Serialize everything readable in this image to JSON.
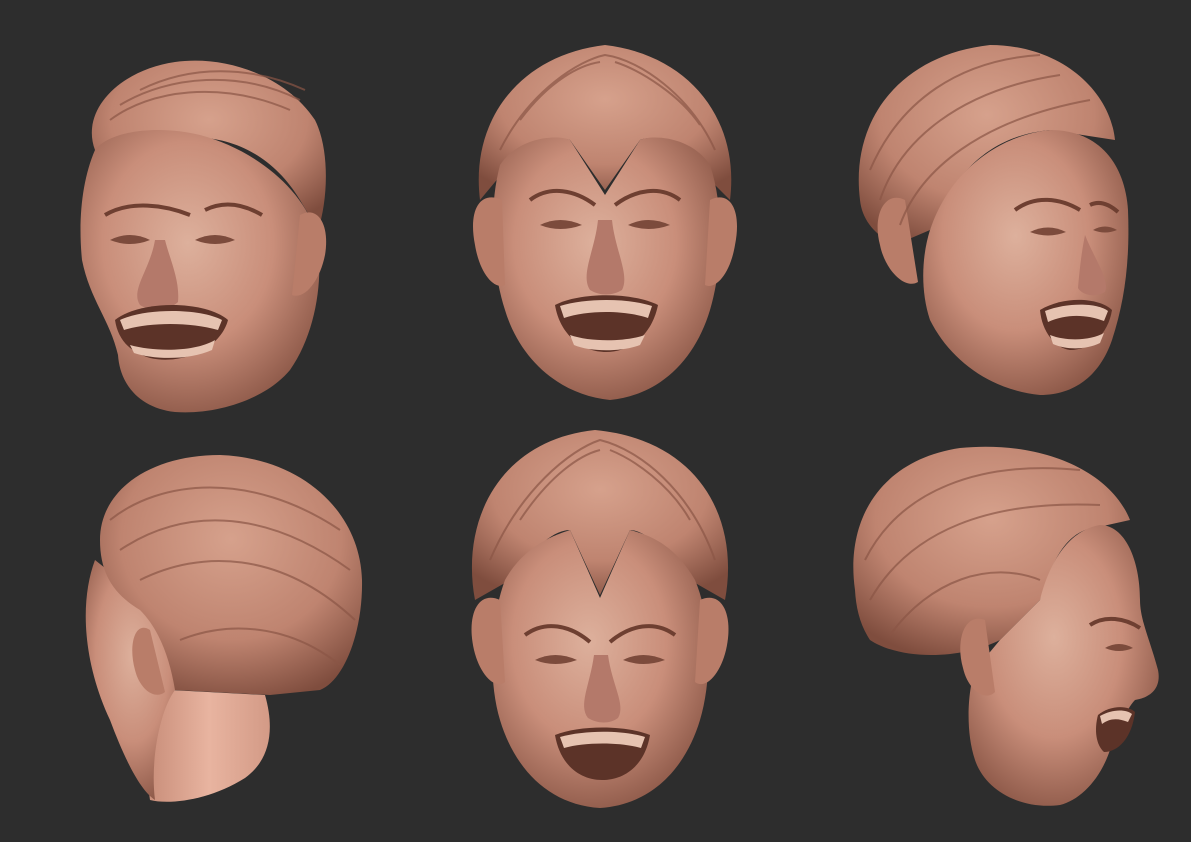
{
  "canvas": {
    "background_color": "#2d2d2d"
  },
  "palette": {
    "clay_base": "#c98e7a",
    "clay_light": "#ddb09c",
    "clay_shadow": "#8a5646",
    "clay_deep": "#5c3328",
    "teeth": "#e6c3b1",
    "neck_cut": "#e3aa97"
  },
  "views": [
    {
      "name": "view-three-quarter-left",
      "angle": "three-quarter-left"
    },
    {
      "name": "view-front",
      "angle": "front"
    },
    {
      "name": "view-three-quarter-right",
      "angle": "three-quarter-right"
    },
    {
      "name": "view-back-left",
      "angle": "back-left"
    },
    {
      "name": "view-front-tilted-up",
      "angle": "front-tilted"
    },
    {
      "name": "view-profile-right",
      "angle": "profile-right"
    }
  ]
}
